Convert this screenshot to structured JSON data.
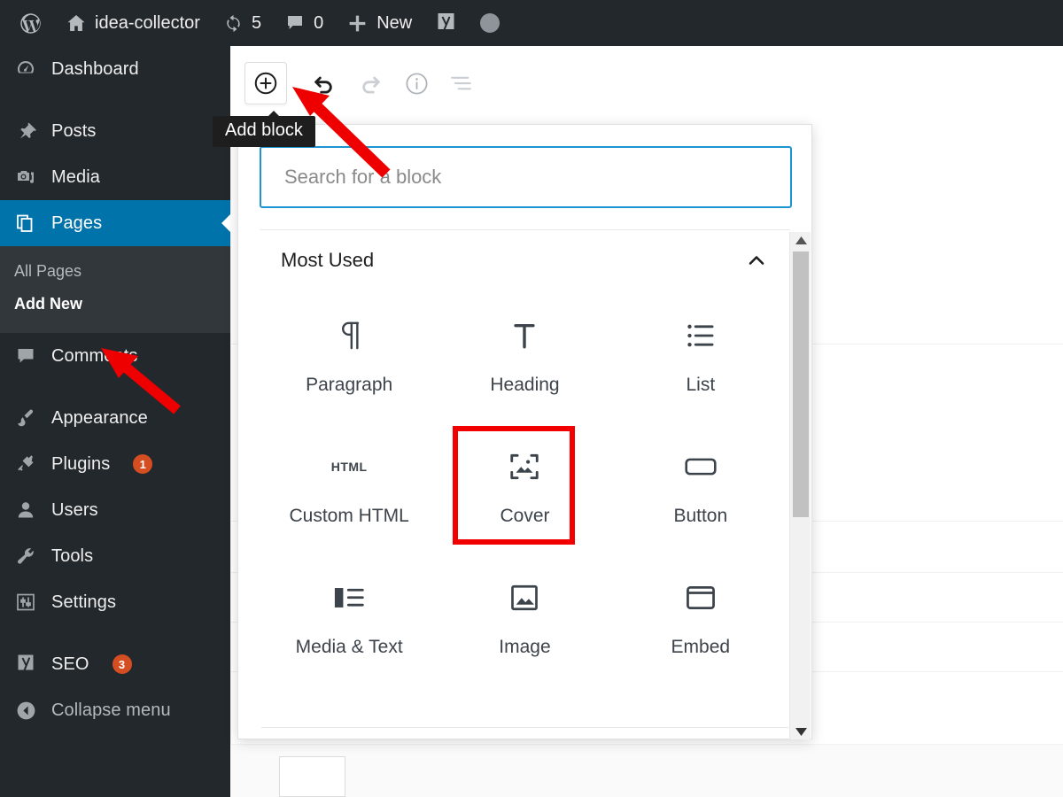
{
  "adminbar": {
    "wp_logo_icon": "wordpress-logo-icon",
    "site_name": "idea-collector",
    "site_icon": "home-icon",
    "updates_icon": "updates-icon",
    "updates_count": "5",
    "comments_icon": "comment-bubble-icon",
    "comments_count": "0",
    "new_icon": "plus-icon",
    "new_label": "New",
    "seo_icon": "yoast-seo-icon",
    "avatar_icon": "user-avatar-icon"
  },
  "sidebar": {
    "items": [
      {
        "label": "Dashboard",
        "icon": "dashboard-icon",
        "badge": ""
      },
      {
        "label": "Posts",
        "icon": "pin-icon",
        "badge": ""
      },
      {
        "label": "Media",
        "icon": "camera-icon",
        "badge": ""
      },
      {
        "label": "Pages",
        "icon": "pages-icon",
        "badge": "",
        "active": true
      },
      {
        "label": "Comments",
        "icon": "comment-icon",
        "badge": ""
      },
      {
        "label": "Appearance",
        "icon": "paintbrush-icon",
        "badge": ""
      },
      {
        "label": "Plugins",
        "icon": "plug-icon",
        "badge": "1"
      },
      {
        "label": "Users",
        "icon": "user-icon",
        "badge": ""
      },
      {
        "label": "Tools",
        "icon": "wrench-icon",
        "badge": ""
      },
      {
        "label": "Settings",
        "icon": "sliders-icon",
        "badge": ""
      },
      {
        "label": "SEO",
        "icon": "yoast-seo-icon",
        "badge": "3"
      }
    ],
    "submenu": [
      {
        "label": "All Pages",
        "current": false
      },
      {
        "label": "Add New",
        "current": true
      }
    ],
    "collapse": {
      "label": "Collapse menu",
      "icon": "collapse-arrow-icon"
    }
  },
  "toolbar": {
    "add_block": {
      "name": "add-block-button",
      "icon": "plus-circle-icon"
    },
    "undo": {
      "name": "undo-button",
      "icon": "undo-arrow-icon"
    },
    "redo": {
      "name": "redo-button",
      "icon": "redo-arrow-icon"
    },
    "details": {
      "name": "content-info-button",
      "icon": "info-circle-icon"
    },
    "list_view": {
      "name": "list-view-button",
      "icon": "list-view-icon"
    }
  },
  "tooltip": {
    "text": "Add block"
  },
  "inserter": {
    "search": {
      "placeholder": "Search for a block",
      "value": ""
    },
    "section": {
      "title": "Most Used",
      "collapse_icon": "chevron-up-icon"
    },
    "blocks": [
      {
        "label": "Paragraph",
        "icon": "paragraph-icon",
        "highlight": false
      },
      {
        "label": "Heading",
        "icon": "heading-icon",
        "highlight": false
      },
      {
        "label": "List",
        "icon": "list-icon",
        "highlight": false
      },
      {
        "label": "Custom HTML",
        "icon": "html-icon",
        "highlight": false
      },
      {
        "label": "Cover",
        "icon": "cover-icon",
        "highlight": true
      },
      {
        "label": "Button",
        "icon": "button-icon",
        "highlight": false
      },
      {
        "label": "Media & Text",
        "icon": "media-text-icon",
        "highlight": false
      },
      {
        "label": "Image",
        "icon": "image-icon",
        "highlight": false
      },
      {
        "label": "Embed",
        "icon": "embed-icon",
        "highlight": false
      }
    ],
    "scrollbar": {
      "up_icon": "scroll-up-arrow-icon",
      "down_icon": "scroll-down-arrow-icon"
    }
  },
  "annotations": {
    "arrow_color": "#ee0000",
    "highlight_color": "#f20000",
    "arrows": [
      {
        "name": "arrow-to-add-block",
        "points_to": "add-block-button"
      },
      {
        "name": "arrow-to-add-new",
        "points_to": "sidebar-subitem-add-new"
      }
    ]
  },
  "colors": {
    "admin_dark": "#23282d",
    "submenu_dark": "#32373c",
    "active_blue": "#0073aa",
    "badge_orange": "#d54e21",
    "focus_blue": "#1e95d3"
  }
}
